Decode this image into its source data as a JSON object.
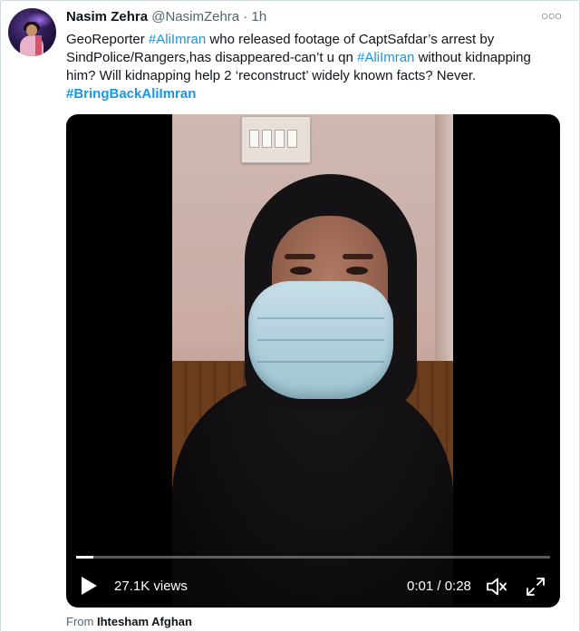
{
  "tweet": {
    "author_name": "Nasim Zehra",
    "handle": "@NasimZehra",
    "separator": "·",
    "time": "1h",
    "more_icon": "more-horizontal-icon",
    "text": {
      "p1": "GeoReporter ",
      "hashtag1": "#AliImran",
      "p2": " who released footage of CaptSafdar’s arrest by SindPolice/Rangers,has disappeared-can’t u qn ",
      "hashtag2": "#AliImran",
      "p3": " without kidnapping him? Will kidnapping help 2 ‘reconstruct’ widely known facts? Never. ",
      "hashtag3": "#BringBackAliImran"
    }
  },
  "video": {
    "views": "27.1K views",
    "time": "0:01 / 0:28",
    "progress": 0.036,
    "play_icon": "play-icon",
    "mute_icon": "volume-muted-icon",
    "fullscreen_icon": "expand-icon"
  },
  "attribution": {
    "label": "From",
    "name": "Ihtesham Afghan"
  },
  "colors": {
    "link": "#1b95e0",
    "text": "#0f1419",
    "muted": "#536471",
    "border": "#cfd9de"
  }
}
